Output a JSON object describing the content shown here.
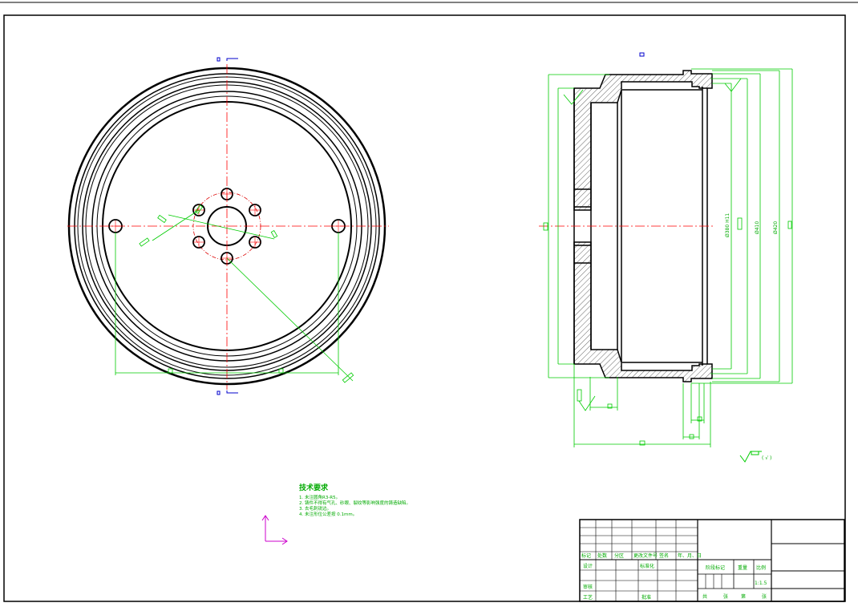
{
  "colors": {
    "outline": "#000000",
    "dimension": "#00cc00",
    "centerline": "#ff0000",
    "annotation": "#00aa00",
    "axis": "#cc00cc",
    "marker": "#0000cc"
  },
  "tech_notes": {
    "title": "技术要求",
    "lines": [
      "1. 未注圆角R3-R5。",
      "2. 铸件不得有气孔、砂眼、裂纹等影响强度的铸造缺陷。",
      "3. 去毛刺锐边。",
      "4. 未注形位公差按 0.1mm。"
    ]
  },
  "surface_finish": {
    "value": "( √ )"
  },
  "dimension_labels": {
    "dia_inner": "Ø380 H11",
    "dia_mid": "Ø410",
    "dia_outer": "Ø420"
  },
  "title_block": {
    "row_labels": [
      "标记",
      "处数",
      "分区",
      "更改文件号",
      "签名",
      "年、月、日"
    ],
    "design": "设计",
    "standardize": "标准化",
    "review": "审核",
    "process": "工艺",
    "approve": "批准",
    "stage_mark": "阶段标记",
    "weight": "重量",
    "scale": "比例",
    "scale_value": "1:1.5",
    "sheets_total": "共",
    "sheets": "张",
    "sheet_no": "第",
    "sheet_unit": "张"
  }
}
